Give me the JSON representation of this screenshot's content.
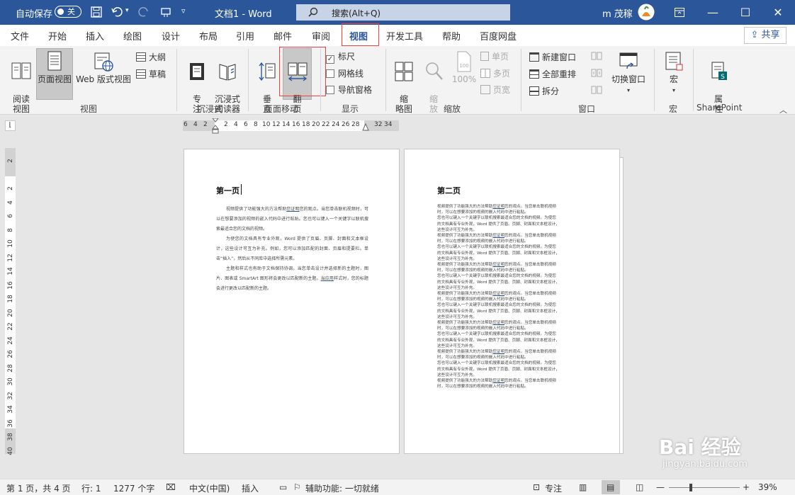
{
  "titlebar": {
    "autosave_label": "自动保存",
    "autosave_state": "关",
    "doc_title": "文档1  -  Word",
    "search_placeholder": "搜索(Alt+Q)",
    "user_name": "m 茂稼"
  },
  "tabs": [
    "文件",
    "开始",
    "插入",
    "绘图",
    "设计",
    "布局",
    "引用",
    "邮件",
    "审阅",
    "视图",
    "开发工具",
    "帮助",
    "百度网盘"
  ],
  "active_tab": "视图",
  "share_label": "共享",
  "ribbon": {
    "view_group": {
      "label": "视图",
      "read_mode": "阅读\n视图",
      "print_layout": "页面视图",
      "web_layout": "Web 版式视图",
      "outline": "大纲",
      "draft": "草稿"
    },
    "immersive_group": {
      "label": "沉浸式",
      "focus": "专\n注",
      "immersive_reader": "沉浸式\n阅读器"
    },
    "page_move_group": {
      "label": "页面移动",
      "vertical": "垂\n直",
      "side_to_side": "翻\n页"
    },
    "show_group": {
      "label": "显示",
      "ruler": "标尺",
      "gridlines": "网格线",
      "nav_pane": "导航窗格",
      "ruler_checked": true
    },
    "zoom_group": {
      "label": "缩放",
      "thumbnails": "缩\n略图",
      "zoom": "缩\n放",
      "zoom100": "100%",
      "one_page": "单页",
      "multi_page": "多页",
      "page_width": "页宽"
    },
    "window_group": {
      "label": "窗口",
      "new_window": "新建窗口",
      "arrange_all": "全部重排",
      "split": "拆分",
      "switch_window": "切换窗口"
    },
    "macro_group": {
      "label": "宏",
      "macros": "宏"
    },
    "sharepoint_group": {
      "label": "SharePoint",
      "properties": "属\n性"
    }
  },
  "ruler": {
    "ticks": [
      "6",
      "4",
      "2",
      "2",
      "4",
      "6",
      "8",
      "10",
      "12",
      "14",
      "16",
      "18",
      "20",
      "22",
      "24",
      "26",
      "28",
      "32",
      "34"
    ],
    "vticks": [
      "2",
      "2",
      "4",
      "6",
      "8",
      "10",
      "12",
      "14",
      "16",
      "18",
      "20",
      "22",
      "24",
      "26",
      "28",
      "30",
      "32",
      "34",
      "36",
      "38",
      "40"
    ]
  },
  "page1": {
    "title": "第一页",
    "p1a": "视频提供了功能强大的方法帮助",
    "p1link": "您证明",
    "p1b": "您的观点。当您单击联机视频时，可以在想要添加的视频的嵌入代码中进行粘贴。您也可以键入一个关键字以联机搜索最适合您的文档的视频。",
    "p2": "为使您的文档具有专业外观，Word 提供了页眉、页脚、封面和文本框设计，这些设计可互为补充。例如，您可以添加匹配的封面、页眉和提要栏。单击“插入”，然后从不同库中选择所需元素。",
    "p3a": "主题和样式也有助于文档保持协调。当您单击设计并选择新的主题时，图片、图表或 SmartArt 图形将会更改以匹配新的主题。",
    "p3link": "当应用",
    "p3b": "样式时，您的标题会进行更改以匹配新的主题。"
  },
  "page2": {
    "title": "第二页",
    "line1a": "视频提供了功能强大的方法帮助",
    "line1link": "您证明",
    "line1b": "您的观点。当您单击联机视频",
    "line2": "时，可以在想要添加的视频的嵌入代码中进行粘贴。",
    "line3": "您也可以键入一个关键字以联机搜索最适合您的文档的视频。为使您",
    "line4": "的文档具有专业外观，Word 提供了页眉、页脚、封面和文本框设计，",
    "line5": "这些设计可互为补充。"
  },
  "status": {
    "page": "第 1 页，共 4 页",
    "row": "行: 1",
    "words": "1277 个字",
    "language": "中文(中国)",
    "insert": "插入",
    "accessibility": "辅助功能: 一切就绪",
    "focus": "专注",
    "zoom": "39%"
  },
  "watermark": {
    "brand": "Bai 经验",
    "url": "jingyan.baidu.com"
  },
  "colors": {
    "accent": "#2b579a",
    "highlight": "#e84545"
  }
}
